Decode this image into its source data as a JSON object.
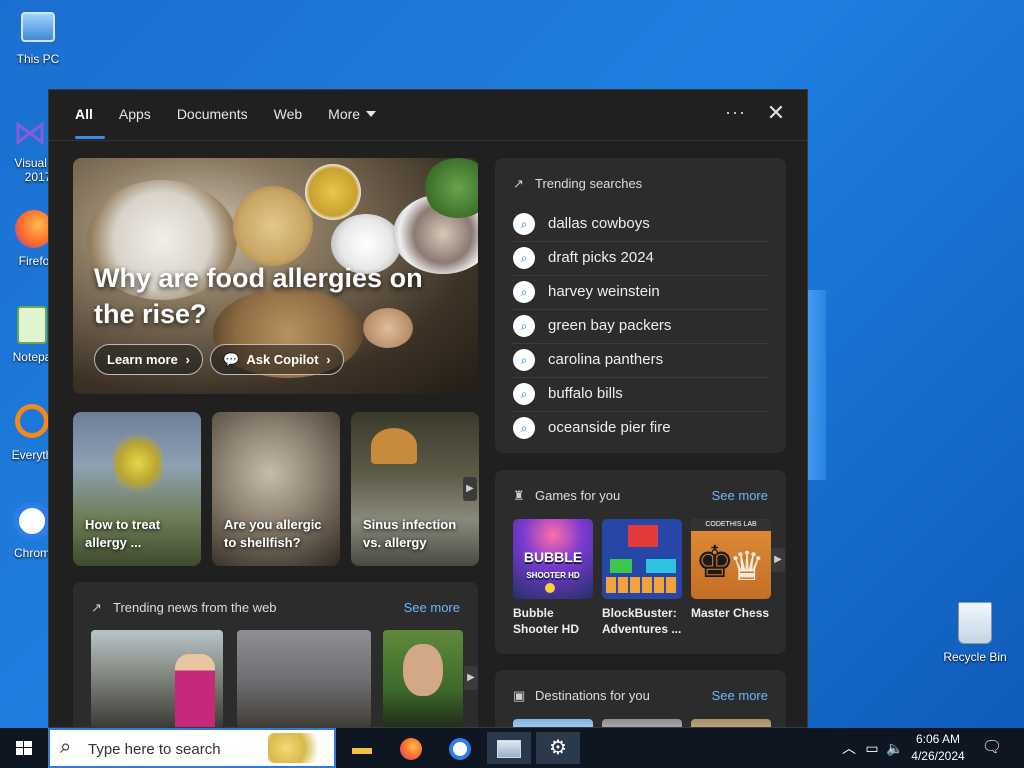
{
  "desktop": {
    "icons": [
      {
        "label": "This PC",
        "icon": "this-pc-icon"
      },
      {
        "label": "Visual St 2017",
        "icon": "visual-studio-icon"
      },
      {
        "label": "Firefo",
        "icon": "firefox-icon"
      },
      {
        "label": "Notepa",
        "icon": "notepad-icon"
      },
      {
        "label": "Everyth",
        "icon": "everything-icon"
      },
      {
        "label": "Chrom",
        "icon": "chrome-icon"
      },
      {
        "label": "Recycle Bin",
        "icon": "recycle-bin-icon"
      }
    ]
  },
  "tabs": [
    {
      "label": "All",
      "active": true
    },
    {
      "label": "Apps"
    },
    {
      "label": "Documents"
    },
    {
      "label": "Web"
    },
    {
      "label": "More"
    }
  ],
  "toolbar": {
    "more_options": "···",
    "close": "✕"
  },
  "hero": {
    "title": "Why are food allergies on the rise?",
    "learn_more": "Learn more",
    "ask_copilot": "Ask Copilot"
  },
  "cards": [
    {
      "caption": "How to treat allergy ..."
    },
    {
      "caption": "Are you allergic to shellfish?"
    },
    {
      "caption": "Sinus infection vs. allergy"
    }
  ],
  "trending_searches": {
    "title": "Trending searches",
    "items": [
      "dallas cowboys",
      "draft picks 2024",
      "harvey weinstein",
      "green bay packers",
      "carolina panthers",
      "buffalo bills",
      "oceanside pier fire"
    ]
  },
  "games": {
    "title": "Games for you",
    "see_more": "See more",
    "items": [
      {
        "name": "Bubble Shooter HD",
        "logo": "BUBBLE",
        "logo_sub": "SHOOTER HD"
      },
      {
        "name": "BlockBuster: Adventures ..."
      },
      {
        "name": "Master Chess",
        "badge": "CODETHIS LAB"
      }
    ]
  },
  "news": {
    "title": "Trending news from the web",
    "see_more": "See more"
  },
  "destinations": {
    "title": "Destinations for you",
    "see_more": "See more"
  },
  "taskbar": {
    "search_placeholder": "Type here to search",
    "time": "6:06 AM",
    "date": "4/26/2024"
  },
  "colors": {
    "accent": "#3a8de0",
    "link": "#6cb6ff",
    "panel": "#202020",
    "card": "#2c2c2c"
  }
}
